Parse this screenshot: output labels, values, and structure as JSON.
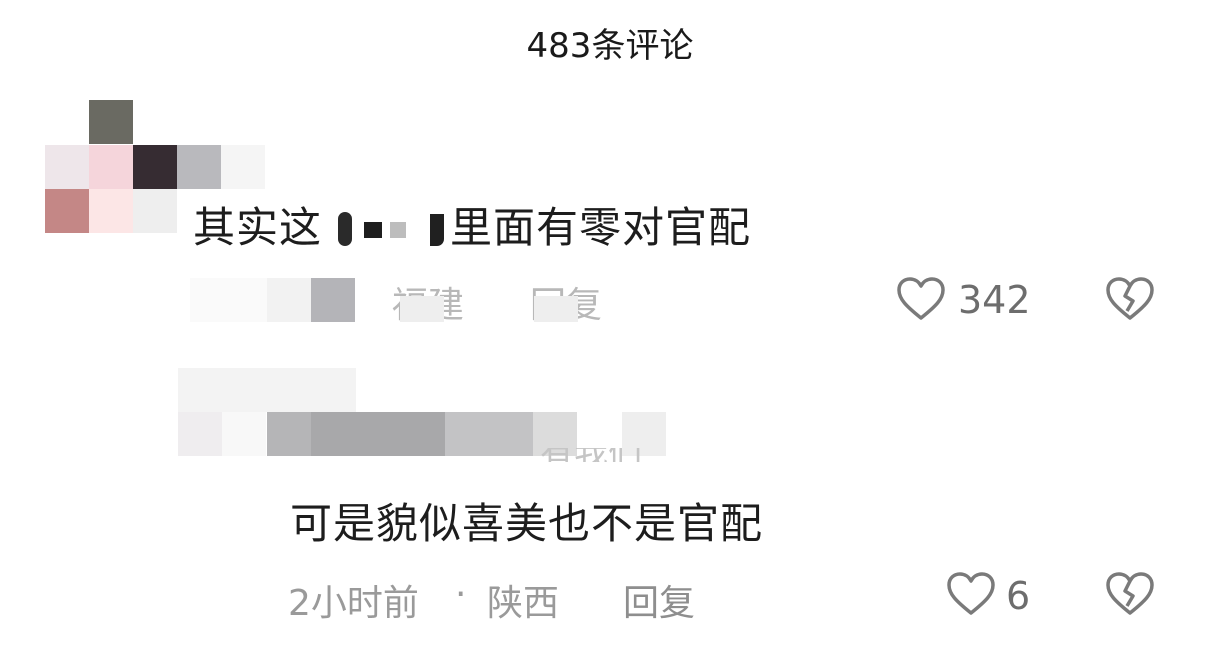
{
  "header": {
    "title": "483条评论"
  },
  "comments": [
    {
      "text_visible_left": "其实这",
      "text_visible_right": "里面有零对官配",
      "meta_partial": "福建",
      "reply_partial": "回复",
      "likes": "342"
    },
    {
      "reply_to_partial": "有我们",
      "text": "可是貌似喜美也不是官配",
      "time": "2小时前",
      "location": "陕西",
      "reply_label": "回复",
      "likes": "6"
    }
  ],
  "icons": {
    "like": "heart-outline-icon",
    "dislike": "broken-heart-icon"
  },
  "colors": {
    "text": "#1d1d1d",
    "meta": "#9a9a9a",
    "icon": "#7a7a7a"
  }
}
